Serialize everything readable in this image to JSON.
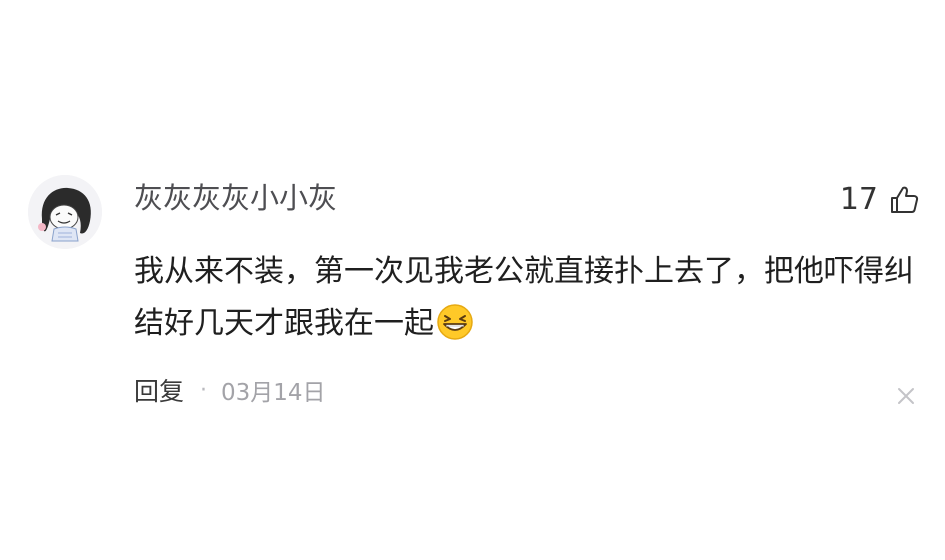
{
  "comment": {
    "username": "灰灰灰灰小小灰",
    "like_count": "17",
    "text": "我从来不装，第一次见我老公就直接扑上去了，把他吓得纠结好几天才跟我在一起",
    "reply_label": "回复",
    "separator": "·",
    "date": "03月14日"
  },
  "icons": {
    "avatar": "avatar-cartoon-girl",
    "like": "thumbs-up-icon",
    "emoji": "grinning-squint-emoji",
    "close": "close-icon"
  },
  "colors": {
    "username": "#4e4e52",
    "text": "#1f1f1f",
    "meta": "#a3a3a8",
    "emoji": "#ffc928"
  }
}
